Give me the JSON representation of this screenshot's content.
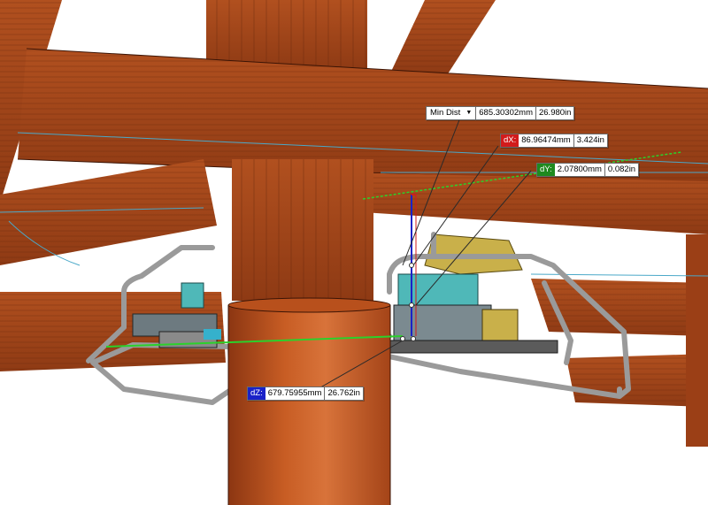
{
  "measure": {
    "min_dist": {
      "label": "Min Dist",
      "value_mm": "685.30302mm",
      "value_in": "26.980in"
    },
    "dx": {
      "label": "dX:",
      "value_mm": "86.96474mm",
      "value_in": "3.424in",
      "color": "#d21b1b"
    },
    "dy": {
      "label": "dY:",
      "value_mm": "2.07800mm",
      "value_in": "0.082in",
      "color": "#1f8a1f"
    },
    "dz": {
      "label": "dZ:",
      "value_mm": "679.75955mm",
      "value_in": "26.762in",
      "color": "#1a22c8"
    }
  },
  "icons": {
    "dropdown": "chevron-down-icon"
  },
  "colors": {
    "timber": "#a8481c",
    "timber_dark": "#7a2f0e",
    "post": "#c0561e",
    "edge_line": "#4aa8c8",
    "frame_tube": "#b5b5b5",
    "measure_line": "#2bd12b"
  }
}
